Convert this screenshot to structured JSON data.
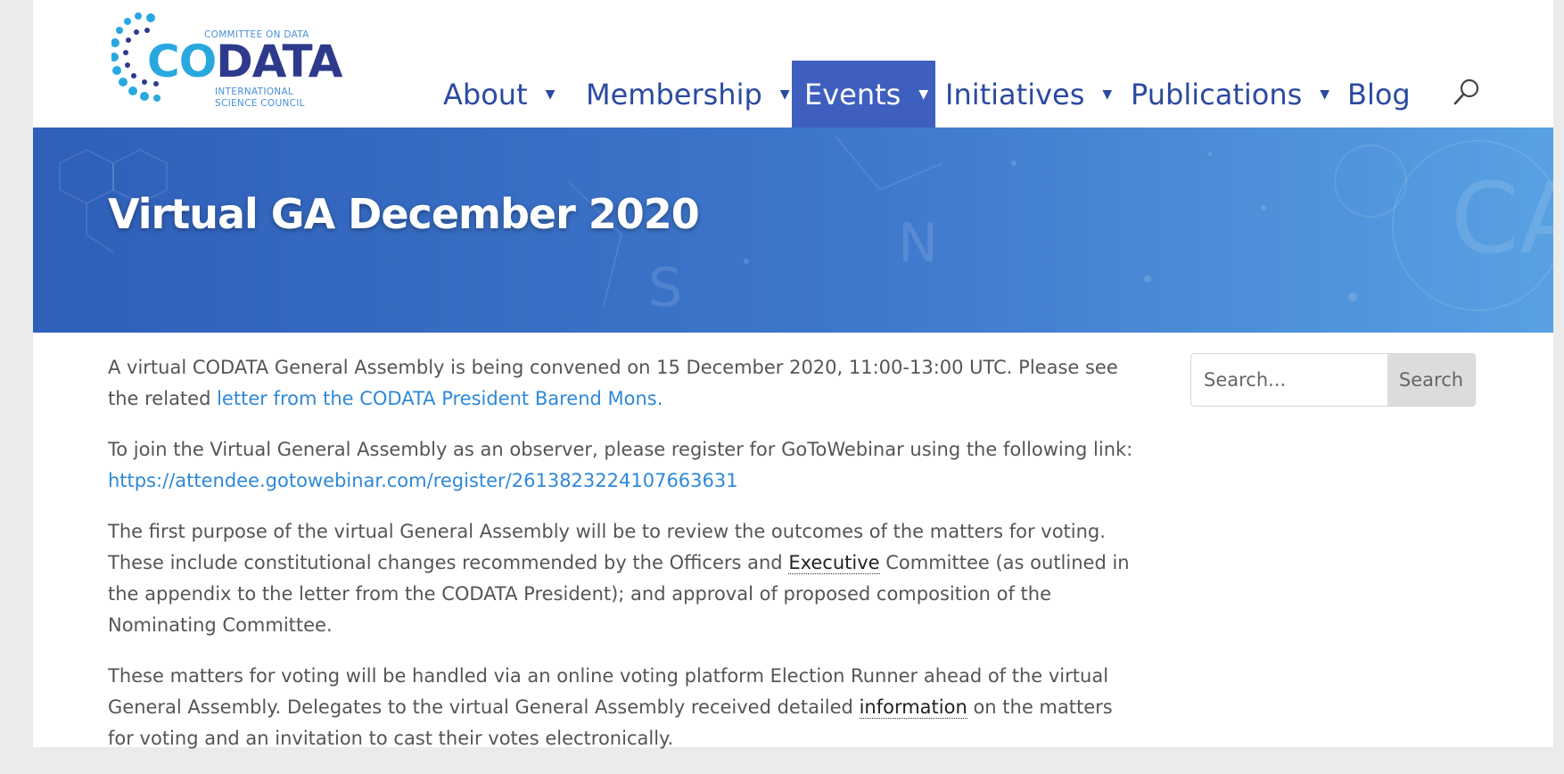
{
  "brand": {
    "committee_text": "COMMITTEE ON DATA",
    "logo_co": "CO",
    "logo_data": "DATA",
    "subtitle_line1": "INTERNATIONAL",
    "subtitle_line2": "SCIENCE COUNCIL"
  },
  "nav": {
    "items": [
      {
        "label": "About",
        "caret": "▼"
      },
      {
        "label": "Membership",
        "caret": "▼"
      },
      {
        "label": "Events",
        "caret": "▼"
      },
      {
        "label": "Initiatives",
        "caret": "▼"
      },
      {
        "label": "Publications",
        "caret": "▼"
      },
      {
        "label": "Blog"
      }
    ],
    "active_item": "Events",
    "search_icon": "search-icon"
  },
  "banner": {
    "title": "Virtual GA December 2020"
  },
  "content": {
    "p1_text": "A virtual CODATA General Assembly is being convened on 15 December 2020, 11:00-13:00 UTC. Please see the related ",
    "p1_link": "letter from the CODATA President Barend Mons.",
    "p2_text": "To join the Virtual General Assembly as an observer, please register for GoToWebinar using the following link:",
    "p2_link": "https://attendee.gotowebinar.com/register/2613823224107663631",
    "p3_text_a": "The first purpose of the virtual General Assembly will be to review the outcomes of the matters for voting. These include constitutional changes recommended by the Officers and ",
    "p3_link": "Executive",
    "p3_text_b": " Committee (as outlined in the appendix to the letter from the CODATA President); and approval of proposed composition of the Nominating Committee.",
    "p4_text_a": "These matters for voting will be handled via an online voting platform Election Runner ahead of the virtual General Assembly. Delegates to the virtual General Assembly received detailed ",
    "p4_link": "information",
    "p4_text_b": " on the matters for voting and an invitation to cast their votes electronically."
  },
  "sidebar": {
    "search_placeholder": "Search...",
    "search_button": "Search"
  },
  "colors": {
    "nav_text": "#2b4aa0",
    "nav_active_bg": "#3f5fbf",
    "banner_start": "#2f5fb9",
    "banner_end": "#58a1e2",
    "link": "#2e88d8",
    "body_text": "#555555"
  }
}
